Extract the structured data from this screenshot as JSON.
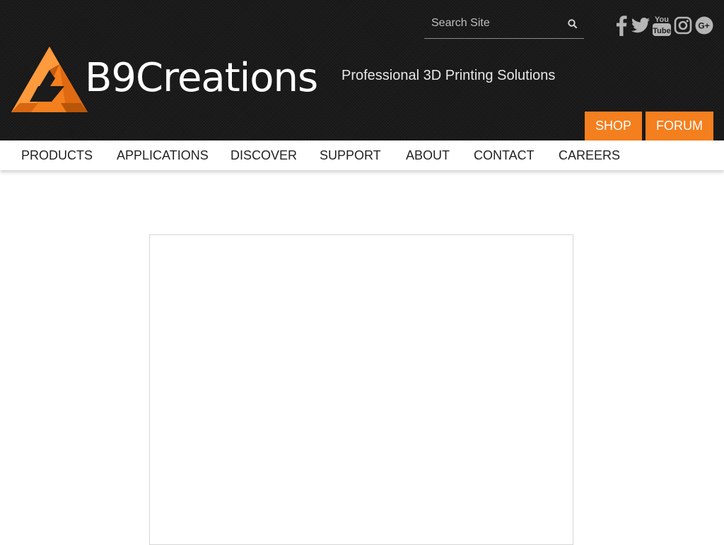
{
  "search": {
    "placeholder": "Search Site",
    "value": "",
    "icon": "search-icon"
  },
  "social": [
    {
      "name": "facebook",
      "icon": "facebook-icon"
    },
    {
      "name": "twitter",
      "icon": "twitter-icon"
    },
    {
      "name": "youtube",
      "icon": "youtube-icon",
      "label_top": "You",
      "label_bottom": "Tube"
    },
    {
      "name": "instagram",
      "icon": "instagram-icon"
    },
    {
      "name": "google-plus",
      "icon": "google-plus-icon",
      "label": "G+"
    }
  ],
  "logo": {
    "text": "B9Creations",
    "icon": "b9-triangle-logo-icon"
  },
  "tagline": "Professional 3D Printing Solutions",
  "cta": {
    "shop": "SHOP",
    "forum": "FORUM"
  },
  "nav": {
    "items": [
      {
        "label": "PRODUCTS"
      },
      {
        "label": "APPLICATIONS"
      },
      {
        "label": "DISCOVER"
      },
      {
        "label": "SUPPORT"
      },
      {
        "label": "ABOUT"
      },
      {
        "label": "CONTACT"
      },
      {
        "label": "CAREERS"
      }
    ]
  },
  "colors": {
    "header_bg": "#1b1b1b",
    "accent": "#f47f1e",
    "social_icon": "#b5b5b5",
    "nav_text": "#222222",
    "frame_border": "#d6d6d6"
  }
}
